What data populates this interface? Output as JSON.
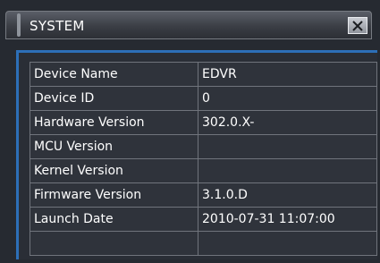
{
  "window": {
    "title": "SYSTEM",
    "close_icon": "close-icon"
  },
  "info": {
    "rows": [
      {
        "label": "Device Name",
        "value": "EDVR"
      },
      {
        "label": "Device ID",
        "value": "0"
      },
      {
        "label": "Hardware Version",
        "value": "302.0.X-"
      },
      {
        "label": "MCU Version",
        "value": ""
      },
      {
        "label": "Kernel Version",
        "value": ""
      },
      {
        "label": "Firmware Version",
        "value": "3.1.0.D"
      },
      {
        "label": "Launch Date",
        "value": "2010-07-31 11:07:00"
      },
      {
        "label": "",
        "value": ""
      }
    ]
  },
  "colors": {
    "accent_border": "#2d6fb8",
    "background": "#262a31"
  }
}
